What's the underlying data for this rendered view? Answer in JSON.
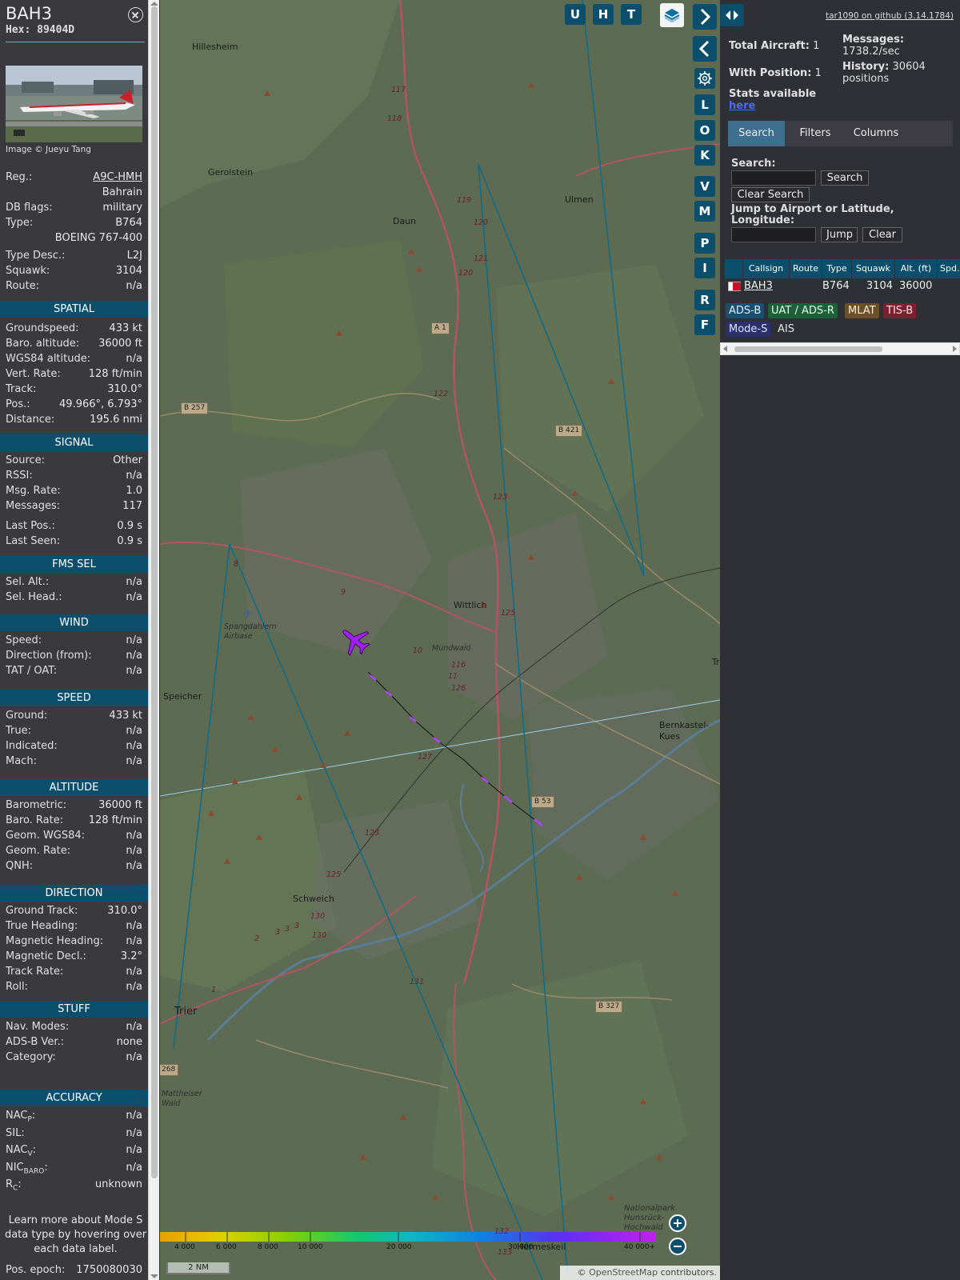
{
  "aircraft": {
    "callsign": "BAH3",
    "hex_label": "Hex:",
    "hex": "89404D",
    "photo_credit": "Image © Jueyu Tang"
  },
  "info": {
    "registration": {
      "label": "Reg.:",
      "value": "A9C-HMH"
    },
    "country": "Bahrain",
    "db_flags": {
      "label": "DB flags:",
      "value": "military"
    },
    "type": {
      "label": "Type:",
      "value": "B764"
    },
    "type_name": "BOEING 767-400",
    "type_desc": {
      "label": "Type Desc.:",
      "value": "L2J"
    },
    "squawk": {
      "label": "Squawk:",
      "value": "3104"
    },
    "route": {
      "label": "Route:",
      "value": "n/a"
    }
  },
  "sections": {
    "spatial": "SPATIAL",
    "signal": "SIGNAL",
    "fms_sel": "FMS SEL",
    "wind": "WIND",
    "speed": "SPEED",
    "altitude": "ALTITUDE",
    "direction": "DIRECTION",
    "stuff": "STUFF",
    "accuracy": "ACCURACY"
  },
  "spatial": [
    {
      "label": "Groundspeed:",
      "value": "433 kt"
    },
    {
      "label": "Baro. altitude:",
      "value": "36000 ft"
    },
    {
      "label": "WGS84 altitude:",
      "value": "n/a"
    },
    {
      "label": "Vert. Rate:",
      "value": "128 ft/min"
    },
    {
      "label": "Track:",
      "value": "310.0°"
    },
    {
      "label": "Pos.:",
      "value": "49.966°, 6.793°"
    },
    {
      "label": "Distance:",
      "value": "195.6 nmi"
    }
  ],
  "signal": [
    {
      "label": "Source:",
      "value": "Other"
    },
    {
      "label": "RSSI:",
      "value": "n/a"
    },
    {
      "label": "Msg. Rate:",
      "value": "1.0"
    },
    {
      "label": "Messages:",
      "value": "117"
    },
    {
      "label": "Last Pos.:",
      "value": "0.9 s"
    },
    {
      "label": "Last Seen:",
      "value": "0.9 s"
    }
  ],
  "fms_sel": [
    {
      "label": "Sel. Alt.:",
      "value": "n/a"
    },
    {
      "label": "Sel. Head.:",
      "value": "n/a"
    }
  ],
  "wind": [
    {
      "label": "Speed:",
      "value": "n/a"
    },
    {
      "label": "Direction (from):",
      "value": "n/a"
    },
    {
      "label": "TAT / OAT:",
      "value": "n/a"
    }
  ],
  "speed": [
    {
      "label": "Ground:",
      "value": "433 kt"
    },
    {
      "label": "True:",
      "value": "n/a"
    },
    {
      "label": "Indicated:",
      "value": "n/a"
    },
    {
      "label": "Mach:",
      "value": "n/a"
    }
  ],
  "altitude": [
    {
      "label": "Barometric:",
      "value": "36000 ft"
    },
    {
      "label": "Baro. Rate:",
      "value": "128 ft/min"
    },
    {
      "label": "Geom. WGS84:",
      "value": "n/a"
    },
    {
      "label": "Geom. Rate:",
      "value": "n/a"
    },
    {
      "label": "QNH:",
      "value": "n/a"
    }
  ],
  "direction": [
    {
      "label": "Ground Track:",
      "value": "310.0°"
    },
    {
      "label": "True Heading:",
      "value": "n/a"
    },
    {
      "label": "Magnetic Heading:",
      "value": "n/a"
    },
    {
      "label": "Magnetic Decl.:",
      "value": "3.2°"
    },
    {
      "label": "Track Rate:",
      "value": "n/a"
    },
    {
      "label": "Roll:",
      "value": "n/a"
    }
  ],
  "stuff": [
    {
      "label": "Nav. Modes:",
      "value": "n/a"
    },
    {
      "label": "ADS-B Ver.:",
      "value": "none"
    },
    {
      "label": "Category:",
      "value": "n/a"
    }
  ],
  "accuracy": [
    {
      "label": "NAC",
      "sub": "P",
      "suffix": ":",
      "value": "n/a"
    },
    {
      "label": "SIL:",
      "sub": "",
      "suffix": "",
      "value": "n/a"
    },
    {
      "label": "NAC",
      "sub": "V",
      "suffix": ":",
      "value": "n/a"
    },
    {
      "label": "NIC",
      "sub": "BARO",
      "suffix": ":",
      "value": "n/a"
    },
    {
      "label": "R",
      "sub": "C",
      "suffix": ":",
      "value": "unknown"
    }
  ],
  "footnote": "Learn more about Mode S data type by hovering over each data label.",
  "pos_epoch": {
    "label": "Pos. epoch:",
    "value": "1750080030"
  },
  "map": {
    "buttons": [
      "U",
      "H",
      "T",
      "L",
      "O",
      "K",
      "V",
      "M",
      "P",
      "I",
      "R",
      "F"
    ],
    "places": [
      "Hillesheim",
      "Gerolstein",
      "Daun",
      "Ulmen",
      "Wittlich",
      "Spangdahlem Airbase",
      "Speicher",
      "Bernkastel-Kues",
      "Schweich",
      "Trier",
      "Mattheiser Wald",
      "Hermeskeil",
      "Nationalpark Hunsrück-Hochwald",
      "Mundwald",
      "Tra"
    ],
    "road_signs": [
      "A 1",
      "B 257",
      "B 421",
      "B 53",
      "B 327",
      "268"
    ],
    "road_numbers": [
      "117",
      "118",
      "119",
      "120",
      "121",
      "120",
      "122",
      "123",
      "125",
      "8",
      "9",
      "10",
      "116",
      "11",
      "126",
      "127",
      "123",
      "125",
      "130",
      "130",
      "2",
      "3",
      "3",
      "3",
      "131",
      "1",
      "132",
      "133"
    ],
    "altitude_scale": [
      "4 000",
      "6 000",
      "8 000",
      "10 000",
      "20 000",
      "30 000",
      "40 000+"
    ],
    "scale_bar": "2 NM",
    "attribution_prefix": "© ",
    "attribution_link": "OpenStreetMap",
    "attribution_suffix": " contributors."
  },
  "sidebar": {
    "github": "tar1090 on github (3.14.1784)",
    "total_aircraft_label": "Total Aircraft:",
    "total_aircraft": "1",
    "with_position_label": "With Position:",
    "with_position": "1",
    "stats_label": "Stats available",
    "stats_link": "here",
    "messages_label": "Messages:",
    "messages_rate": "1738.2/sec",
    "history_label": "History:",
    "history_value": "30604",
    "history_unit": "positions",
    "tabs": [
      "Search",
      "Filters",
      "Columns"
    ],
    "search_label": "Search:",
    "search_button": "Search",
    "clear_search_button": "Clear Search",
    "jump_label": "Jump to Airport or Latitude, Longitude:",
    "jump_button": "Jump",
    "clear_button": "Clear",
    "columns": [
      "Callsign",
      "Route",
      "Type",
      "Squawk",
      "Alt. (ft)",
      "Spd."
    ],
    "row": {
      "callsign": "BAH3",
      "route": "",
      "type": "B764",
      "squawk": "3104",
      "altitude": "36000"
    },
    "sources": [
      "ADS-B",
      "UAT / ADS-R",
      "MLAT",
      "TIS-B",
      "Mode-S",
      "AIS"
    ]
  },
  "colors": {
    "accent": "#0b4f6c",
    "panel": "#3a3a3e",
    "sidebar": "#2f3035",
    "aircraft": "#a020f0",
    "adsb": "#1a4f6f",
    "uat": "#1f5f3a",
    "mlat": "#6b4f2a",
    "tisb": "#7a2030",
    "modes": "#2a2f6e"
  }
}
